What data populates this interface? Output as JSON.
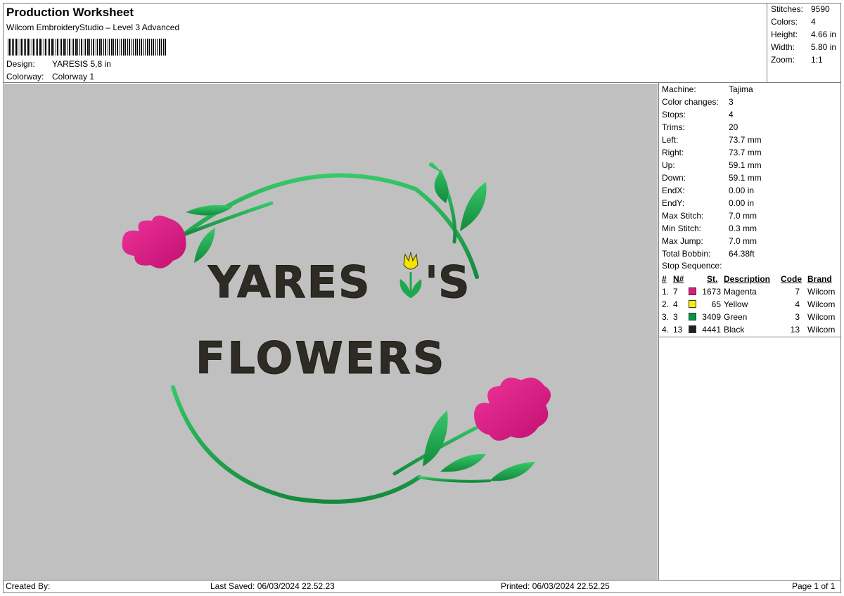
{
  "header": {
    "title": "Production Worksheet",
    "subtitle": "Wilcom EmbroideryStudio – Level 3 Advanced",
    "design_label": "Design:",
    "design_value": "YARESIS 5,8 in",
    "colorway_label": "Colorway:",
    "colorway_value": "Colorway 1"
  },
  "summary": [
    {
      "label": "Stitches:",
      "value": "9590"
    },
    {
      "label": "Colors:",
      "value": "4"
    },
    {
      "label": "Height:",
      "value": "4.66 in"
    },
    {
      "label": "Width:",
      "value": "5.80 in"
    },
    {
      "label": "Zoom:",
      "value": "1:1"
    }
  ],
  "details": [
    {
      "label": "Machine:",
      "value": "Tajima"
    },
    {
      "label": "Color changes:",
      "value": "3"
    },
    {
      "label": "Stops:",
      "value": "4"
    },
    {
      "label": "Trims:",
      "value": "20"
    },
    {
      "label": "Left:",
      "value": "73.7 mm"
    },
    {
      "label": "Right:",
      "value": "73.7 mm"
    },
    {
      "label": "Up:",
      "value": "59.1 mm"
    },
    {
      "label": "Down:",
      "value": "59.1 mm"
    },
    {
      "label": "EndX:",
      "value": "0.00 in"
    },
    {
      "label": "EndY:",
      "value": "0.00 in"
    },
    {
      "label": "Max Stitch:",
      "value": "7.0 mm"
    },
    {
      "label": "Min Stitch:",
      "value": "0.3 mm"
    },
    {
      "label": "Max Jump:",
      "value": "7.0 mm"
    },
    {
      "label": "Total Bobbin:",
      "value": "64.38ft"
    }
  ],
  "stop_sequence": {
    "title": "Stop Sequence:",
    "headers": {
      "num": "#",
      "n": "N#",
      "st": "St.",
      "description": "Description",
      "code": "Code",
      "brand": "Brand"
    },
    "rows": [
      {
        "num": "1.",
        "n": "7",
        "color": "#e0197f",
        "st": "1673",
        "description": "Magenta",
        "code": "7",
        "brand": "Wilcom"
      },
      {
        "num": "2.",
        "n": "4",
        "color": "#f5f000",
        "st": "65",
        "description": "Yellow",
        "code": "4",
        "brand": "Wilcom"
      },
      {
        "num": "3.",
        "n": "3",
        "color": "#009a44",
        "st": "3409",
        "description": "Green",
        "code": "3",
        "brand": "Wilcom"
      },
      {
        "num": "4.",
        "n": "13",
        "color": "#231f1c",
        "st": "4441",
        "description": "Black",
        "code": "13",
        "brand": "Wilcom"
      }
    ]
  },
  "design_artwork": {
    "line1": "YARES",
    "line1_end": "'S",
    "line2": "FLOWERS",
    "text_color": "#2e2b25",
    "green": "#1fa64f",
    "magenta": "#e0197f",
    "yellow": "#f5e400"
  },
  "footer": {
    "created_by": "Created By:",
    "last_saved": "Last Saved: 06/03/2024 22.52.23",
    "printed": "Printed: 06/03/2024 22.52.25",
    "page": "Page 1 of 1"
  }
}
